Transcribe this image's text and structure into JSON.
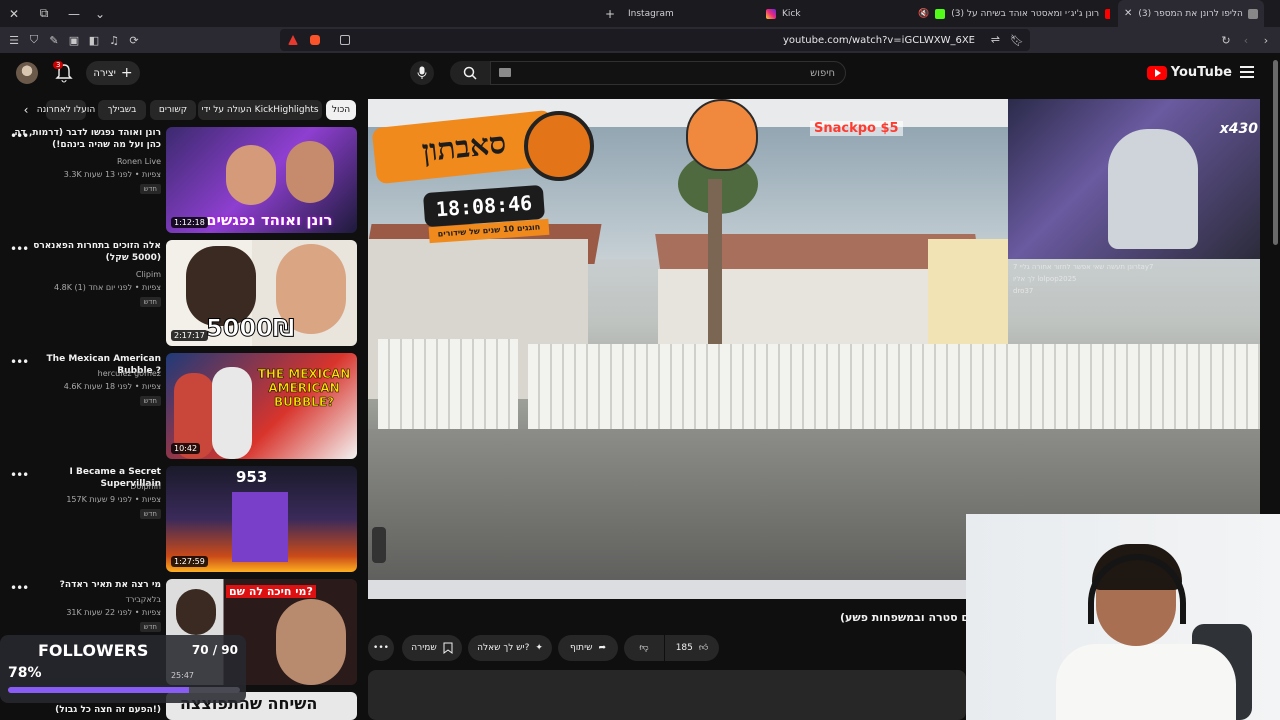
{
  "browser": {
    "tabs": [
      {
        "title": "(3) הליפו לרונן את המספר",
        "active": true
      },
      {
        "title": "(3) רונן ג'יג׳י ומאסטר אוהד בשיחה על",
        "active": false
      },
      {
        "title": "Kick",
        "active": false
      },
      {
        "title": "Instagram",
        "active": false
      }
    ],
    "url": "youtube.com/watch?v=iGCLWXW_6XE"
  },
  "youtube": {
    "logo_text": "YouTube",
    "search_placeholder": "חיפוש",
    "create_label": "יצירה",
    "notification_count": "3"
  },
  "chips": [
    "הכול",
    "העולה על ידי KickHighlights",
    "קשורים",
    "בשבילך",
    "הועלו לאחרונה"
  ],
  "recommended": [
    {
      "title": "רונן ואוהד נפגשו לדבר (דרמות, דה כהן ועל מה שהיה בינהם!)",
      "channel": "Ronen Live",
      "meta": "3.3K ‏‏‏צפיות • לפני 13 שעות",
      "badge": "חדש",
      "duration": "1:12:18",
      "thumb_text": "רונן ואוהד נפגשים"
    },
    {
      "title": "אלה הזוכים בתחרות הפאנארס (5000 שקל)",
      "channel": "Clipim",
      "meta": "4.8K ‏‏‏צפיות • לפני יום אחד (1)",
      "badge": "חדש",
      "duration": "2:17:17",
      "thumb_text": "5000₪"
    },
    {
      "title": "The Mexican American Bubble ?",
      "channel": "herculez gomez",
      "meta": "4.6K ‏‏‏צפיות • לפני 18 שעות",
      "badge": "חדש",
      "duration": "10:42",
      "thumb_text": "THE MEXICAN AMERICAN BUBBLE?"
    },
    {
      "title": "I Became a Secret Supervillain",
      "channel": "Dolphin",
      "meta": "157K ‏‏‏צפיות • לפני 9 שעות",
      "badge": "חדש",
      "duration": "1:27:59",
      "thumb_text": "953"
    },
    {
      "title": "?מי רצה את תאיר ראדה",
      "channel": "בלאקבירד",
      "meta": "31K ‏‏‏צפיות • לפני 22 שעות",
      "badge": "חדש",
      "duration": "",
      "thumb_text": "מי חיכה לה שם?"
    },
    {
      "title": "(הפעם זה חצה כל גבול!)",
      "channel": "",
      "meta": "",
      "badge": "",
      "duration": "",
      "thumb_text": "השיחה שהתפוצצה"
    }
  ],
  "video": {
    "title": "(פרסומה עם סטרה ובמשפחות פשע)",
    "overlay_title": "סאבתון",
    "timer": "18:08:46",
    "timer_sub": "חוגגים 10 שנים של שידורים",
    "snack": "Snackpo $5",
    "counter": "x430",
    "chat": [
      "רונן תעשה שאי אפשר לחזור אחורה גליי 7tay7",
      "לך אליו lolpop2025",
      "dro37"
    ],
    "likes": "185",
    "share_label": "שיתוף",
    "ask_label": "יש לך שאלה?",
    "save_label": "שמירה"
  },
  "followers": {
    "label": "FOLLOWERS",
    "count": "70 / 90",
    "percent": "78%",
    "progress": 0.78,
    "eta": "25:47"
  }
}
